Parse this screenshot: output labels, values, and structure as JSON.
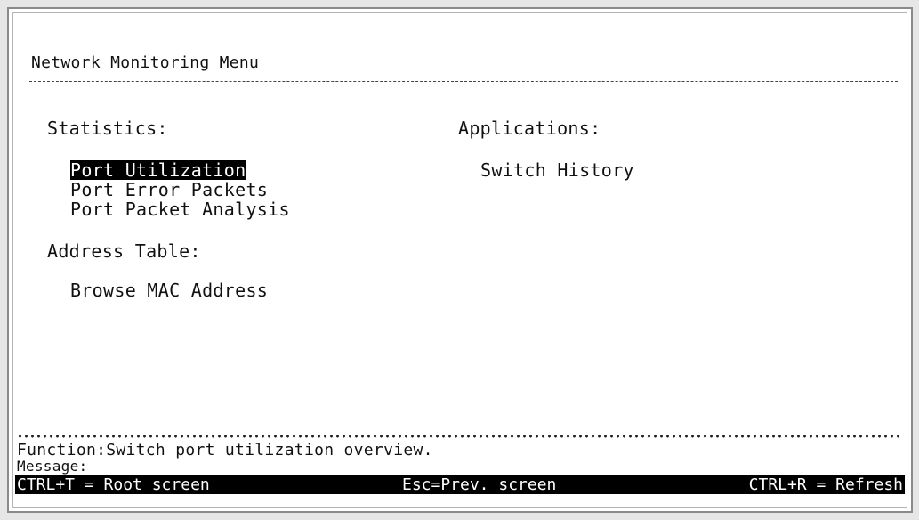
{
  "title": "Network Monitoring Menu",
  "statistics": {
    "heading": "Statistics:",
    "items": [
      "Port Utilization",
      "Port Error Packets",
      "Port Packet Analysis"
    ]
  },
  "applications": {
    "heading": "Applications:",
    "items": [
      "Switch History"
    ]
  },
  "address_table": {
    "heading": "Address Table:",
    "items": [
      "Browse MAC Address"
    ]
  },
  "function_text": "Function:Switch port utilization overview.",
  "message_text": "Message:",
  "shortcuts": [
    "CTRL+T = Root screen",
    "Esc=Prev. screen",
    "CTRL+R = Refresh"
  ],
  "colors": {
    "highlight_bg": "#000000",
    "highlight_fg": "#ffffff"
  }
}
